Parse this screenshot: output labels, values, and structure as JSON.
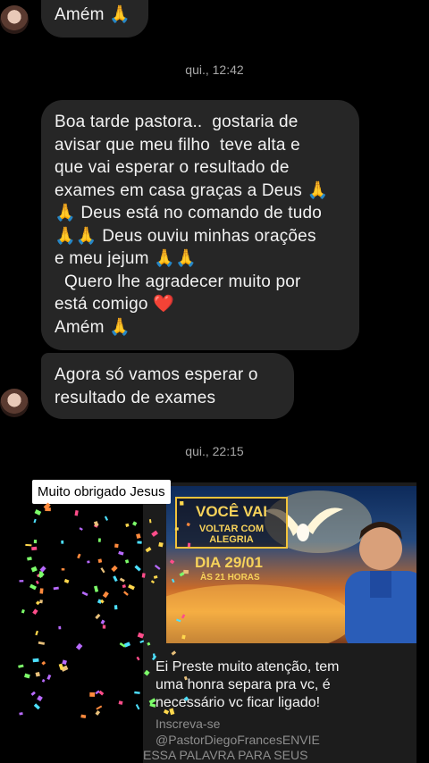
{
  "messages": {
    "amem_top": "Amém 🙏",
    "timestamp1": "qui., 12:42",
    "long_message_lines": [
      "Boa tarde pastora..  gostaria de",
      "avisar que meu filho  teve alta e",
      "que vai esperar o resultado de",
      "exames em casa graças a Deus 🙏",
      "🙏 Deus está no comando de tudo",
      "🙏🙏 Deus ouviu minhas orações",
      "e meu jejum 🙏🙏",
      "  Quero lhe agradecer muito por",
      "está comigo ❤️",
      "Amém 🙏"
    ],
    "second_message_lines": [
      "Agora só vamos esperar o",
      "resultado de exames"
    ],
    "timestamp2": "qui., 22:15"
  },
  "shared_post": {
    "sticker_label": "Muito obrigado Jesus",
    "banner_title_1": "VOCÊ VAI",
    "banner_title_2": "VOLTAR COM ALEGRIA",
    "banner_date": "DIA 29/01",
    "banner_time": "ÀS 21 HORAS",
    "caption_lines": [
      "Ei Preste muito atenção, tem",
      "uma honra separa pra vc, é",
      "necessário vc ficar ligado!"
    ],
    "subscribe_label": "Inscreva-se",
    "channel_handle": "@PastorDiegoFrancesENVIE",
    "cutoff_text": "ESSA PALAVRA PARA SEUS"
  },
  "colors": {
    "background": "#000000",
    "bubble": "#262626",
    "timestamp": "#a8a8a8",
    "banner_gold": "#f2c23a",
    "caption_bg": "#1c1c1c"
  }
}
